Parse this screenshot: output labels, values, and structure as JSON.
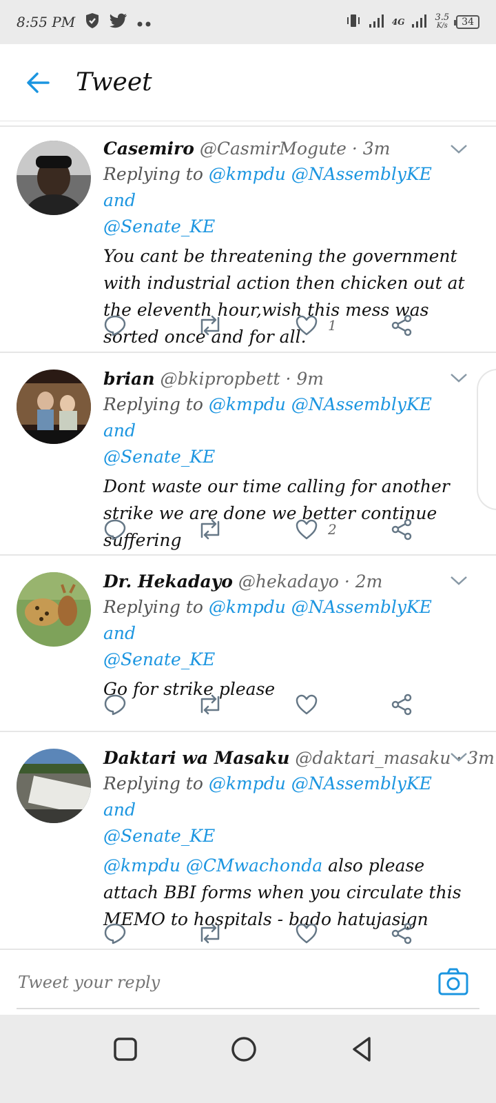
{
  "status_bar": {
    "time": "8:55 PM",
    "network": "4G",
    "speed": "3.5",
    "speed_unit": "K/s",
    "battery": "34"
  },
  "header": {
    "title": "Tweet"
  },
  "tweets": [
    {
      "name": "Casemiro",
      "handle": "@CasmirMogute",
      "time": "· 3m",
      "reply_prefix": "Replying to",
      "mention_line1": "@kmpdu @NAssemblyKE and",
      "mention_line2": "@Senate_KE",
      "text": "You cant be threatening the government with industrial action then chicken out at the eleventh hour,wish this mess was sorted once and for all.",
      "likes": "1"
    },
    {
      "name": "brian",
      "handle": "@bkipropbett",
      "time": "· 9m",
      "reply_prefix": "Replying to",
      "mention_line1": "@kmpdu @NAssemblyKE and",
      "mention_line2": "@Senate_KE",
      "text": "Dont waste our time calling for another strike we are done we better continue suffering",
      "likes": "2"
    },
    {
      "name": "Dr. Hekadayo",
      "handle": "@hekadayo",
      "time": "· 2m",
      "reply_prefix": "Replying to",
      "mention_line1": "@kmpdu @NAssemblyKE and",
      "mention_line2": "@Senate_KE",
      "text": "Go for strike please",
      "likes": ""
    },
    {
      "name": "Daktari wa Masaku",
      "handle": "@daktari_masaku",
      "time": "· 3m",
      "reply_prefix": "Replying to",
      "mention_line1": "@kmpdu @NAssemblyKE and",
      "mention_line2": "@Senate_KE",
      "text_mentions": "@kmpdu @CMwachonda",
      "text": "also please attach BBI forms when you circulate this MEMO to hospitals - bado hatujasign",
      "likes": ""
    }
  ],
  "reply_bar": {
    "placeholder": "Tweet your reply"
  },
  "colors": {
    "accent": "#1b95e0",
    "muted": "#666666",
    "divider": "#e6e6e6"
  },
  "icons": {
    "back": "arrow-left-icon",
    "reply": "speech-bubble-icon",
    "retweet": "retweet-icon",
    "like": "heart-icon",
    "share": "share-icon",
    "more": "chevron-down-icon",
    "camera": "camera-icon"
  }
}
